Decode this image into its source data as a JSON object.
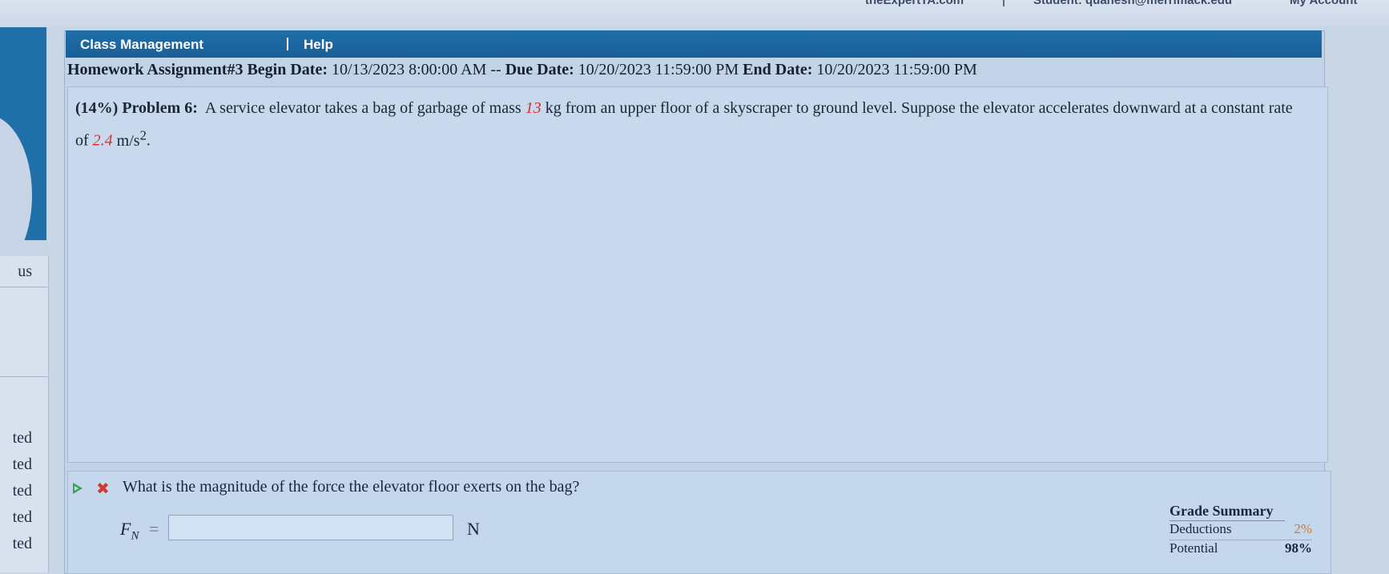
{
  "top_links": {
    "site": "theExpertTA.com",
    "student": "Student: quanesh@merrimack.edu",
    "account": "My Account"
  },
  "left_nav": {
    "heading": "us",
    "items": [
      "ted",
      "ted",
      "ted",
      "ted",
      "ted"
    ]
  },
  "menu": {
    "class_management": "Class Management",
    "help": "Help"
  },
  "assignment": {
    "title": "Homework Assignment#3",
    "begin_label": "Begin Date:",
    "begin_value": "10/13/2023 8:00:00 AM",
    "sep": "--",
    "due_label": "Due Date:",
    "due_value": "10/20/2023 11:59:00 PM",
    "end_label": "End Date:",
    "end_value": "10/20/2023 11:59:00 PM"
  },
  "problem": {
    "weight": "(14%)",
    "label": "Problem 6:",
    "text_a": "A service elevator takes a bag of garbage of mass",
    "mass": "13",
    "text_b": "kg from an upper floor of a skyscraper to ground level. Suppose the elevator accelerates downward at a constant rate of",
    "accel": "2.4",
    "accel_unit": "m/s",
    "accel_exp": "2",
    "end": "."
  },
  "question": {
    "text": "What is the magnitude of the force the elevator floor exerts on the bag?",
    "var": "F",
    "var_sub": "N",
    "eq": "=",
    "input_value": "",
    "unit": "N"
  },
  "grade_summary": {
    "title": "Grade Summary",
    "deductions_label": "Deductions",
    "deductions_value": "2%",
    "potential_label": "Potential",
    "potential_value": "98%"
  },
  "colors": {
    "menu_bar": "#1d6fab",
    "highlight_red": "#d4312e",
    "status_green": "#3aa35a"
  }
}
